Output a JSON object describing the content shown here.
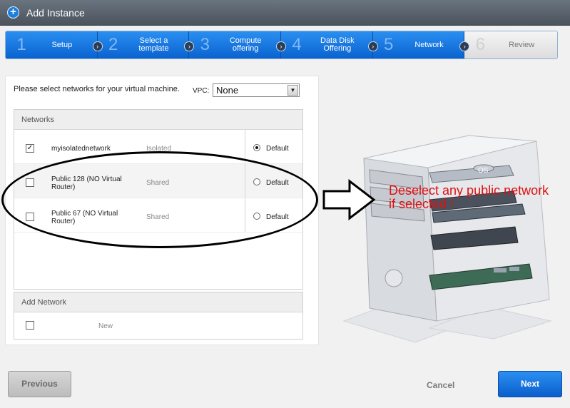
{
  "window": {
    "title": "Add Instance",
    "icon": "plus-circle-icon"
  },
  "steps": [
    {
      "number": "1",
      "label": "Setup",
      "active": true
    },
    {
      "number": "2",
      "label": "Select a template",
      "active": true
    },
    {
      "number": "3",
      "label": "Compute offering",
      "active": true
    },
    {
      "number": "4",
      "label": "Data Disk Offering",
      "active": true
    },
    {
      "number": "5",
      "label": "Network",
      "active": true
    },
    {
      "number": "6",
      "label": "Review",
      "active": false
    }
  ],
  "form": {
    "prompt": "Please select networks for your virtual machine.",
    "vpc_label": "VPC:",
    "vpc_value": "None"
  },
  "networks": {
    "header": "Networks",
    "rows": [
      {
        "name": "myisolatednetwork",
        "type": "Isolated",
        "checked": true,
        "default_label": "Default",
        "default_selected": true
      },
      {
        "name": "Public 128 (NO Virtual Router)",
        "type": "Shared",
        "checked": false,
        "default_label": "Default",
        "default_selected": false
      },
      {
        "name": "Public 67 (NO Virtual Router)",
        "type": "Shared",
        "checked": false,
        "default_label": "Default",
        "default_selected": false
      }
    ]
  },
  "add_network": {
    "header": "Add Network",
    "new_label": "New",
    "checked": false
  },
  "annotation": {
    "text": "Deselect any public network if selected !",
    "color": "#e01010"
  },
  "illustration": {
    "os_label": "OS"
  },
  "buttons": {
    "previous": "Previous",
    "cancel": "Cancel",
    "next": "Next"
  },
  "colors": {
    "accent": "#0a63d0",
    "title_bar": "#555d67"
  }
}
